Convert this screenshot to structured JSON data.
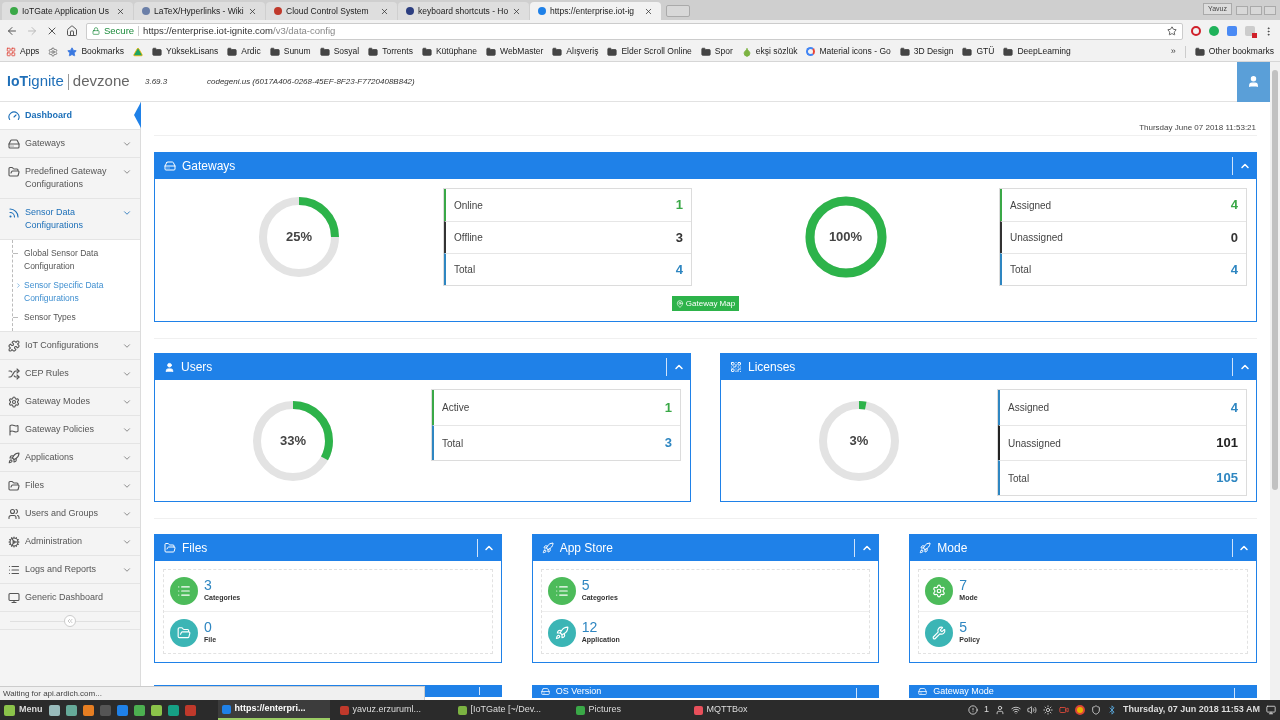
{
  "browser": {
    "tabs": [
      {
        "title": "IoTGate Application Us",
        "selected": false
      },
      {
        "title": "LaTeX/Hyperlinks - Wiki",
        "selected": false
      },
      {
        "title": "Cloud Control System",
        "selected": false
      },
      {
        "title": "keyboard shortcuts - Ho",
        "selected": false
      },
      {
        "title": "https://enterprise.iot-ig",
        "selected": true
      }
    ],
    "profile": "Yavuz",
    "address": {
      "security": "Secure",
      "host": "https://enterprise.iot-ignite.com",
      "path": "/v3/data-config"
    },
    "bookmarks": [
      {
        "label": "Apps",
        "kind": "apps"
      },
      {
        "kind": "gear"
      },
      {
        "label": "Bookmarks",
        "kind": "star"
      },
      {
        "kind": "drive"
      },
      {
        "label": "YüksekLisans",
        "kind": "folder"
      },
      {
        "label": "Ardic",
        "kind": "folder"
      },
      {
        "label": "Sunum",
        "kind": "folder"
      },
      {
        "label": "Sosyal",
        "kind": "folder"
      },
      {
        "label": "Torrents",
        "kind": "folder"
      },
      {
        "label": "Kütüphane",
        "kind": "folder"
      },
      {
        "label": "WebMaster",
        "kind": "folder"
      },
      {
        "label": "Alışveriş",
        "kind": "folder"
      },
      {
        "label": "Elder Scroll Online",
        "kind": "folder"
      },
      {
        "label": "Spor",
        "kind": "folder"
      },
      {
        "label": "ekşi sözlük",
        "kind": "drop"
      },
      {
        "label": "Material icons - Go",
        "kind": "google"
      },
      {
        "label": "3D Design",
        "kind": "folder"
      },
      {
        "label": "GTÜ",
        "kind": "folder"
      },
      {
        "label": "DeepLearning",
        "kind": "folder"
      }
    ],
    "overflow": "»",
    "other": "Other bookmarks"
  },
  "header": {
    "logo": {
      "brand_a": "IoT",
      "brand_b": "ignite",
      "product": "devzone"
    },
    "version": "3.69.3",
    "account": "codegeni.us (6017A406-0268-45EF-8F23-F7720408B842)"
  },
  "sidebar": {
    "items": [
      {
        "label": "Dashboard",
        "kind": "link",
        "selected": true
      },
      {
        "label": "Gateways",
        "kind": "menu",
        "selected": false,
        "expanded": false
      },
      {
        "label": "Predefined Gateway Configurations",
        "kind": "menu",
        "selected": false,
        "expanded": false
      },
      {
        "label": "Sensor Data Configurations",
        "kind": "menu",
        "selected": false,
        "expanded": true,
        "children": [
          {
            "label": "Global Sensor Data Configuration",
            "selected": false
          },
          {
            "label": "Sensor Specific Data Configurations",
            "selected": true
          },
          {
            "label": "Sensor Types",
            "selected": false
          }
        ]
      },
      {
        "label": "IoT Configurations",
        "kind": "menu",
        "selected": false,
        "expanded": false
      },
      {
        "label": "CEP Rules",
        "kind": "menu",
        "selected": false,
        "expanded": false
      },
      {
        "label": "Gateway Modes",
        "kind": "menu",
        "selected": false,
        "expanded": false
      },
      {
        "label": "Gateway Policies",
        "kind": "menu",
        "selected": false,
        "expanded": false
      },
      {
        "label": "Applications",
        "kind": "menu",
        "selected": false,
        "expanded": false
      },
      {
        "label": "Files",
        "kind": "menu",
        "selected": false,
        "expanded": false
      },
      {
        "label": "Users and Groups",
        "kind": "menu",
        "selected": false,
        "expanded": false
      },
      {
        "label": "Administration",
        "kind": "menu",
        "selected": false,
        "expanded": false
      },
      {
        "label": "Logs and Reports",
        "kind": "menu",
        "selected": false,
        "expanded": false
      },
      {
        "label": "Generic Dashboard",
        "kind": "link",
        "selected": false
      }
    ]
  },
  "datetime": "Thursday June 07 2018 11:53:21",
  "gateways_panel": {
    "title": "Gateways",
    "gauges": [
      {
        "percent": "25%",
        "level": 0.25,
        "stats": [
          {
            "label": "Online",
            "value": "1",
            "color": "#3aa847"
          },
          {
            "label": "Offline",
            "value": "3",
            "color": "#333333"
          },
          {
            "label": "Total",
            "value": "4",
            "color": "#2e86c1"
          }
        ]
      },
      {
        "percent": "100%",
        "level": 1,
        "stats": [
          {
            "label": "Assigned",
            "value": "4",
            "color": "#3aa847"
          },
          {
            "label": "Unassigned",
            "value": "0",
            "color": "#333333"
          },
          {
            "label": "Total",
            "value": "4",
            "color": "#2e86c1"
          }
        ]
      }
    ],
    "button": "Gateway Map"
  },
  "users_panel": {
    "title": "Users",
    "gauge": {
      "percent": "33%",
      "level": 0.33,
      "stats": [
        {
          "label": "Active",
          "value": "1",
          "color": "#3aa847"
        },
        {
          "label": "Total",
          "value": "3",
          "color": "#2e86c1"
        }
      ]
    }
  },
  "licenses_panel": {
    "title": "Licenses",
    "gauge": {
      "percent": "3%",
      "level": 0.03,
      "stats": [
        {
          "label": "Assigned",
          "value": "4",
          "color": "#2e86c1"
        },
        {
          "label": "Unassigned",
          "value": "101",
          "color": "#222222"
        },
        {
          "label": "Total",
          "value": "105",
          "color": "#2e86c1"
        }
      ]
    }
  },
  "summary_panels": [
    {
      "title": "Files",
      "metrics": [
        {
          "value": "3",
          "label": "Categories",
          "color": "#4cbb5a"
        },
        {
          "value": "0",
          "label": "File",
          "color": "#3bb5b5"
        }
      ]
    },
    {
      "title": "App Store",
      "metrics": [
        {
          "value": "5",
          "label": "Categories",
          "color": "#4cbb5a"
        },
        {
          "value": "12",
          "label": "Application",
          "color": "#3bb5b5"
        }
      ]
    },
    {
      "title": "Mode",
      "metrics": [
        {
          "value": "7",
          "label": "Mode",
          "color": "#4cbb5a"
        },
        {
          "value": "5",
          "label": "Policy",
          "color": "#3bb5b5"
        }
      ]
    }
  ],
  "partial_panels": [
    {
      "title": "OS Version"
    },
    {
      "title": "Gateway Mode"
    }
  ],
  "status_text": "Waiting for api.ardich.com...",
  "taskbar": {
    "menu": "Menu",
    "windows": [
      {
        "title": "https://enterpri...",
        "selected": true
      },
      {
        "title": "yavuz.erzuruml...",
        "selected": false
      },
      {
        "title": "[IoTGate [~/Dev...",
        "selected": false
      },
      {
        "title": "Pictures",
        "selected": false
      },
      {
        "title": "MQTTBox",
        "selected": false
      }
    ],
    "notifications": "1",
    "clock": "Thursday, 07 Jun 2018 11:53 AM"
  }
}
